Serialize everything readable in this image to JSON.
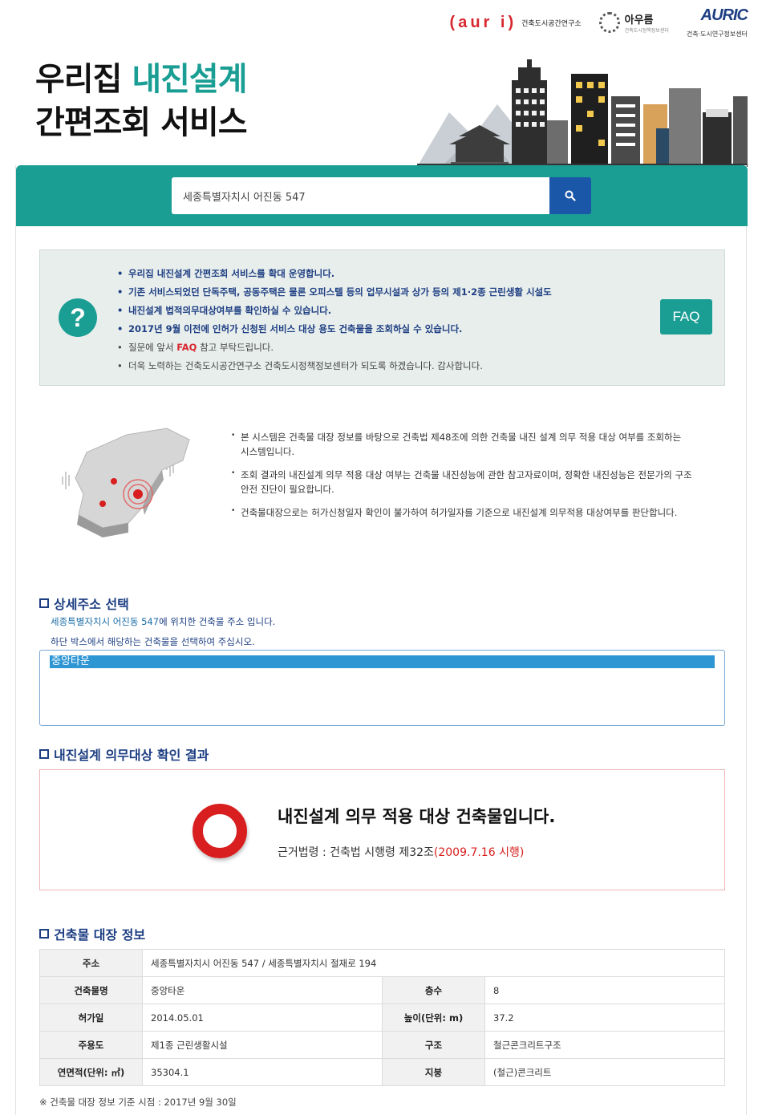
{
  "logos": {
    "auri_mark": "(aur i)",
    "auri_text": "건축도시공간연구소",
    "aurum_name": "아우름",
    "aurum_sub": "건축도시정책정보센터",
    "auric_name": "AURIC",
    "auric_sub": "건축·도시연구정보센터"
  },
  "hero": {
    "line1_plain": "우리집 ",
    "line1_accent": "내진설계",
    "line2": "간편조회 서비스"
  },
  "search": {
    "value": "세종특별자치시 어진동 547",
    "icon": "search-icon"
  },
  "notice": {
    "icon": "question-icon",
    "items": [
      "우리집 내진설계 간편조회 서비스를 확대 운영합니다.",
      "기존 서비스되었던 단독주택, 공동주택은 물론 오피스텔 등의 업무시설과 상가 등의 제1·2종 근린생활 시설도",
      "내진설계 법적의무대상여부를 확인하실 수 있습니다.",
      "2017년 9월 이전에 인허가 신청된 서비스 대상 용도 건축물을 조회하실 수 있습니다.",
      "참고 부탁드립니다.",
      "더욱 노력하는 건축도시공간연구소 건축도시정책정보센터가 되도록 하겠습니다. 감사합니다."
    ],
    "faq_prefix": "질문에 앞서 ",
    "faq_link": "FAQ",
    "faq_button": "FAQ"
  },
  "info": {
    "items": [
      "본 시스템은 건축물 대장 정보를 바탕으로 건축법 제48조에 의한 건축물 내진 설계 의무 적용 대상 여부를 조회하는 시스템입니다.",
      "조회 결과의 내진설계 의무 적용 대상 여부는 건축물 내진성능에 관한 참고자료이며, 정확한 내진성능은 전문가의 구조안전 진단이 필요합니다.",
      "건축물대장으로는 허가신청일자 확인이 불가하여 허가일자를 기준으로 내진설계 의무적용 대상여부를 판단합니다."
    ]
  },
  "detail": {
    "heading": "상세주소 선택",
    "address": "세종특별자치시 어진동 547",
    "line1_suffix": "에 위치한 건축물 주소 입니다.",
    "line2": "하단 박스에서 해당하는 건축물을 선택하여 주십시오.",
    "options": [
      "중앙타운"
    ]
  },
  "result": {
    "heading": "내진설계 의무대상 확인 결과",
    "title": "내진설계 의무 적용 대상 건축물입니다.",
    "basis_prefix": "근거법령 : 건축법 시행령 제32조",
    "basis_date": "(2009.7.16 시행)"
  },
  "registry": {
    "heading": "건축물 대장 정보",
    "address_label": "주소",
    "address_value": "세종특별자치시 어진동 547 / 세종특별자치시 절재로 194",
    "rows": [
      {
        "label1": "건축물명",
        "value1": "중앙타운",
        "label2": "층수",
        "value2": "8"
      },
      {
        "label1": "허가일",
        "value1": "2014.05.01",
        "label2": "높이(단위: m)",
        "value2": "37.2"
      },
      {
        "label1": "주용도",
        "value1": "제1종 근린생활시설",
        "label2": "구조",
        "value2": "철근콘크리트구조"
      },
      {
        "label1": "연면적(단위: ㎡)",
        "value1": "35304.1",
        "label2": "지붕",
        "value2": "(철근)콘크리트"
      }
    ],
    "footnote": "※ 건축물 대장 정보 기준 시점 : 2017년 9월 30일"
  },
  "colors": {
    "teal": "#1a9e94",
    "navy": "#1d3e82",
    "search_button": "#1b57a8",
    "alert_red": "#d81e1e",
    "selected_option": "#2f96d4"
  }
}
